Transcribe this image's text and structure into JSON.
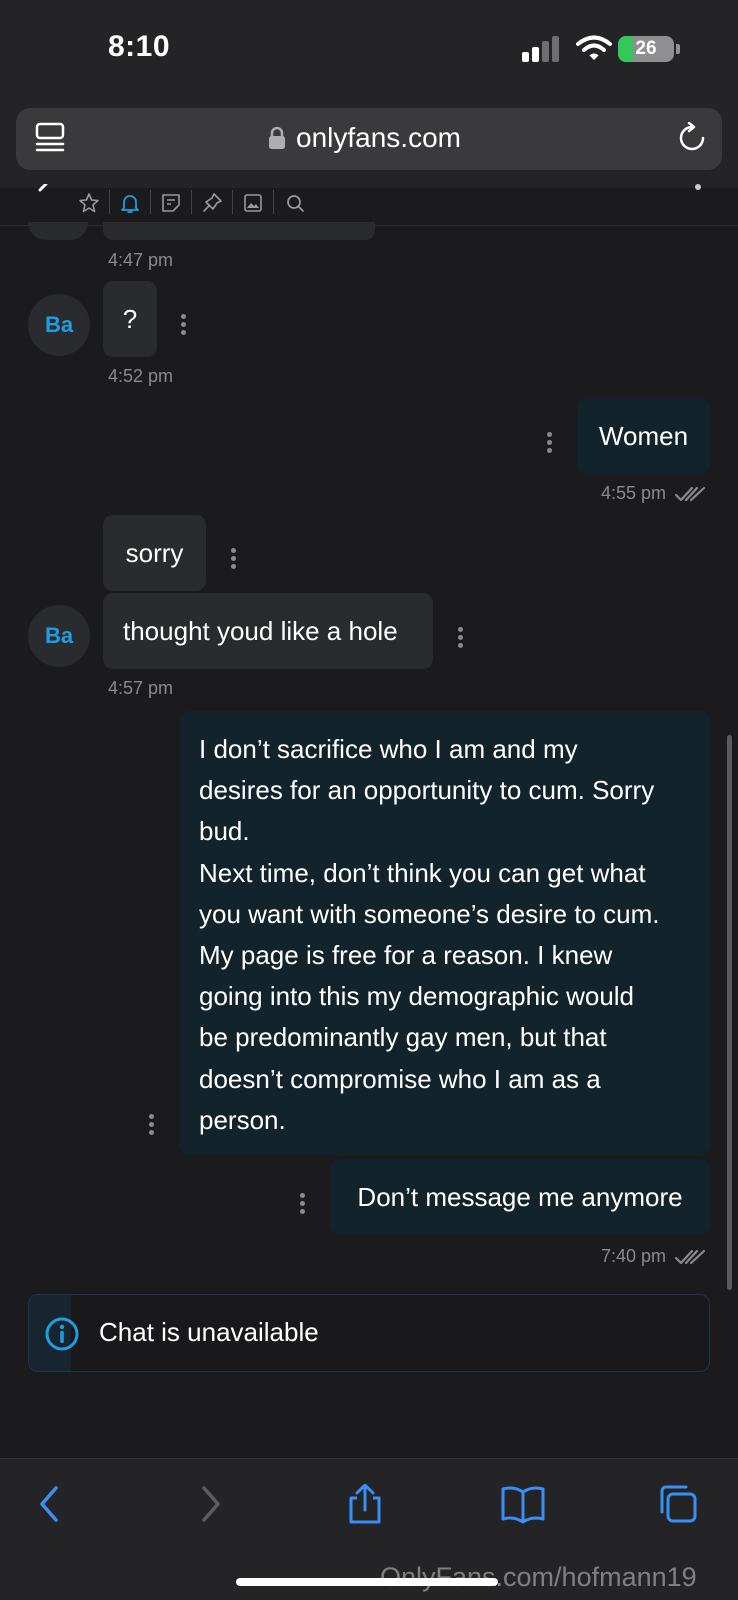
{
  "status_bar": {
    "time": "8:10",
    "battery": "26",
    "battery_level_percent": 26
  },
  "browser": {
    "url": "onlyfans.com"
  },
  "messages": {
    "t1": "4:47 pm",
    "m_q": "?",
    "t2": "4:52 pm",
    "m_women": "Women",
    "t3": "4:55 pm",
    "m_sorry": "sorry",
    "m_hole": "thought youd like a hole",
    "t4": "4:57 pm",
    "m_long_lines": [
      "I don’t sacrifice who I am and my",
      "desires for an opportunity to cum. Sorry",
      "bud.",
      "Next time, don’t think you can get what",
      "you want with someone’s desire to cum.",
      "My page is free for a reason. I knew",
      "going into this my demographic would",
      "be predominantly gay men, but that",
      "doesn’t compromise who I am as a",
      "person."
    ],
    "m_dont": "Don’t message me anymore",
    "t5": "7:40 pm",
    "avatar_initials": "Ba"
  },
  "notice": {
    "text": "Chat is unavailable"
  },
  "watermark": "OnlyFans.com/hofmann19",
  "colors": {
    "accent": "#1e9ee0",
    "safari_blue": "#3a8ff7"
  }
}
